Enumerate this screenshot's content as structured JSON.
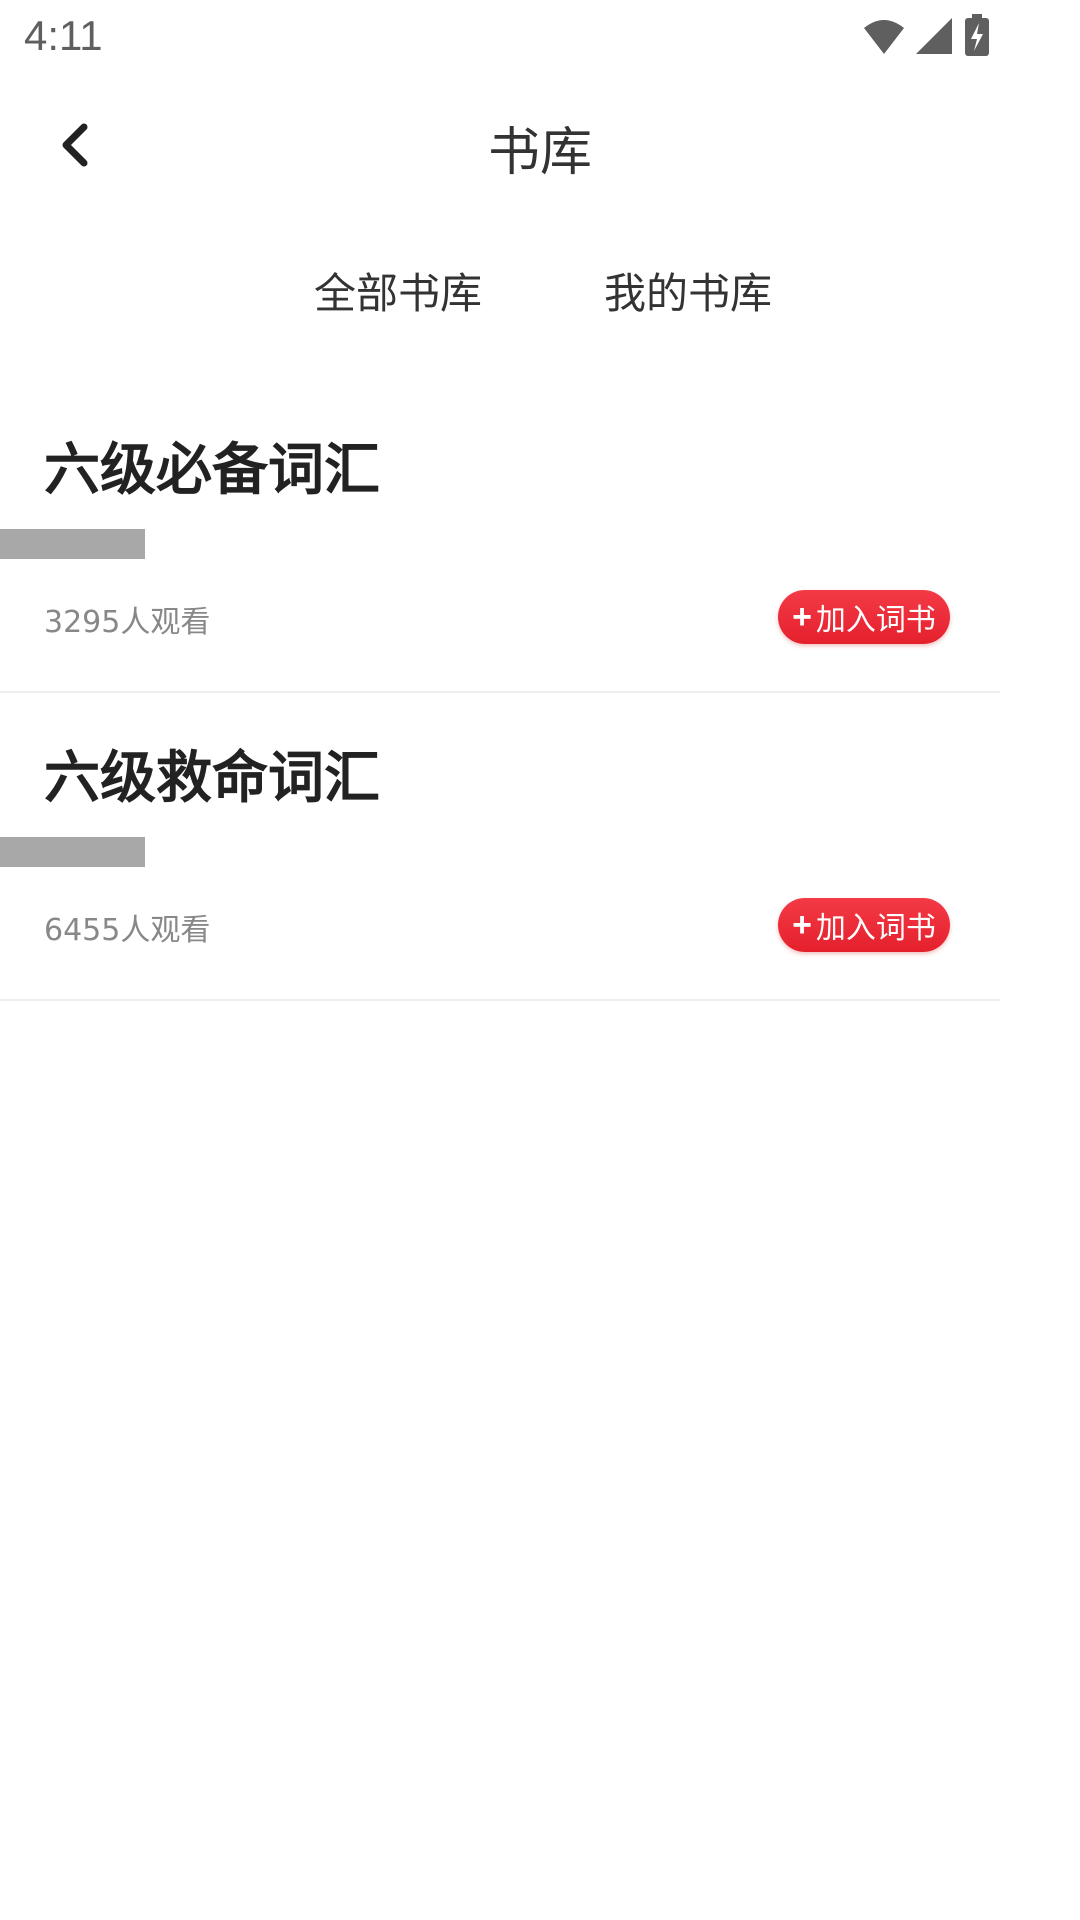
{
  "status_bar": {
    "time": "4:11",
    "icons": [
      "wifi-icon",
      "signal-icon",
      "battery-charging-icon"
    ]
  },
  "header": {
    "back_icon": "chevron-left-icon",
    "title": "书库"
  },
  "tabs": [
    {
      "label": "全部书库"
    },
    {
      "label": "我的书库"
    }
  ],
  "books": [
    {
      "title": "六级必备词汇",
      "views": "3295人观看",
      "add_label": "加入词书",
      "add_icon": "plus-icon"
    },
    {
      "title": "六级救命词汇",
      "views": "6455人观看",
      "add_label": "加入词书",
      "add_icon": "plus-icon"
    }
  ],
  "colors": {
    "accent": "#e5202d",
    "title_text": "#222222",
    "muted_text": "#888888",
    "bar": "#a8a8a8"
  }
}
